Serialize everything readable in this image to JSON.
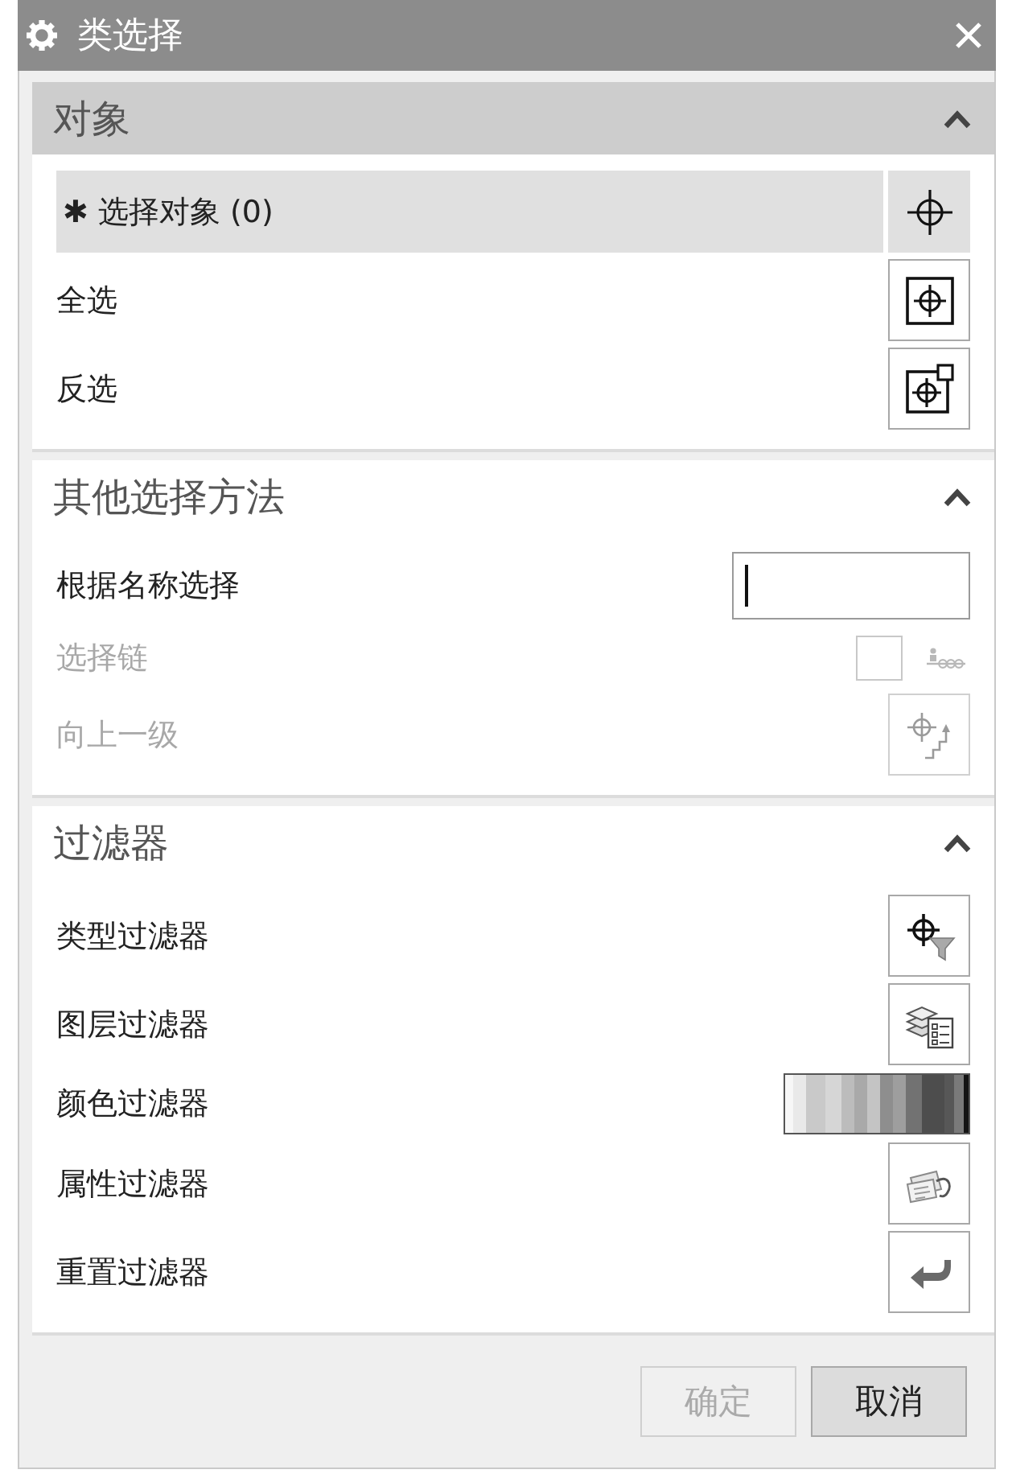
{
  "window": {
    "title": "类选择"
  },
  "sections": [
    {
      "title": "对象",
      "active": true,
      "expanded": true,
      "rows": [
        {
          "kind": "selector",
          "mark": "✱",
          "label": "选择对象 (0)",
          "selected": true,
          "disabled": false
        },
        {
          "kind": "all",
          "label": "全选",
          "selected": false,
          "disabled": false
        },
        {
          "kind": "invert",
          "label": "反选",
          "selected": false,
          "disabled": false
        }
      ]
    },
    {
      "title": "其他选择方法",
      "active": false,
      "expanded": true,
      "rows": [
        {
          "kind": "name",
          "label": "根据名称选择",
          "focused": true,
          "disabled": false
        },
        {
          "kind": "chain",
          "label": "选择链",
          "checked": false,
          "disabled": true
        },
        {
          "kind": "parent",
          "label": "向上一级",
          "disabled": true
        }
      ]
    },
    {
      "title": "过滤器",
      "active": false,
      "expanded": true,
      "rows": [
        {
          "kind": "type",
          "label": "类型过滤器",
          "disabled": false
        },
        {
          "kind": "layer",
          "label": "图层过滤器",
          "disabled": false
        },
        {
          "kind": "color",
          "label": "颜色过滤器",
          "disabled": false
        },
        {
          "kind": "attribute",
          "label": "属性过滤器",
          "disabled": false
        },
        {
          "kind": "reset",
          "label": "重置过滤器",
          "disabled": false
        }
      ]
    }
  ],
  "buttons": [
    {
      "label": "确定",
      "disabled": true
    },
    {
      "label": "取消",
      "disabled": false
    }
  ]
}
